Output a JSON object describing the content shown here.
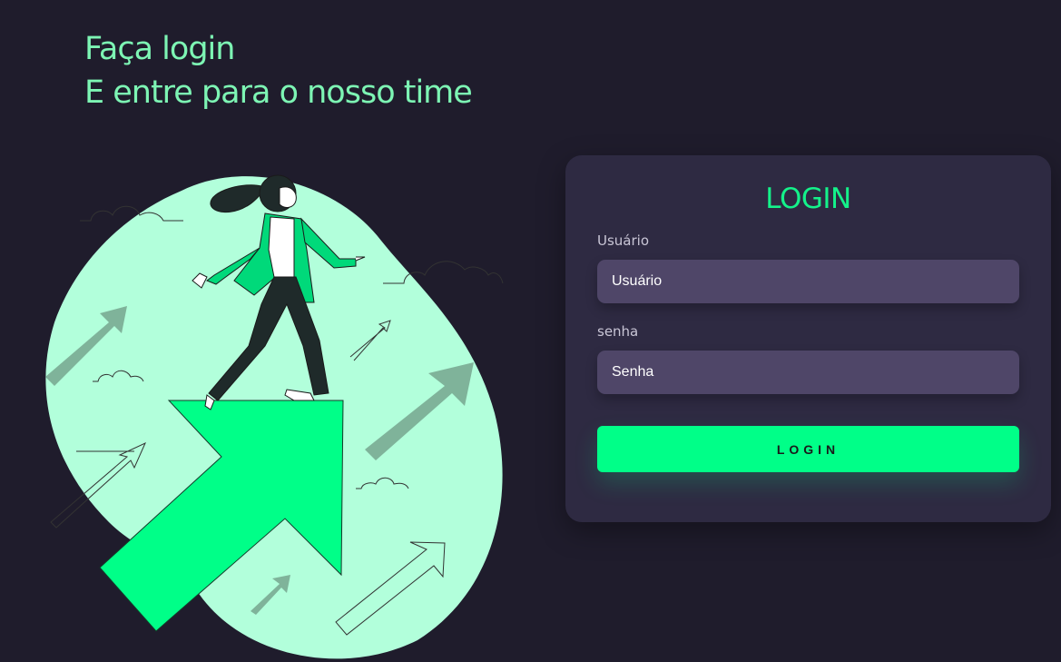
{
  "header": {
    "line1": "Faça login",
    "line2": "E entre para o nosso time"
  },
  "login_card": {
    "title": "LOGIN",
    "username_label": "Usuário",
    "username_placeholder": "Usuário",
    "password_label": "senha",
    "password_placeholder": "Senha",
    "submit_label": "LOGIN"
  },
  "colors": {
    "background": "#1f1c2c",
    "card": "#2e2a42",
    "accent": "#00ff88",
    "headline": "#7df5b4",
    "input": "#4f4668"
  },
  "illustration": {
    "icon": "woman-on-growth-arrow-illustration"
  }
}
